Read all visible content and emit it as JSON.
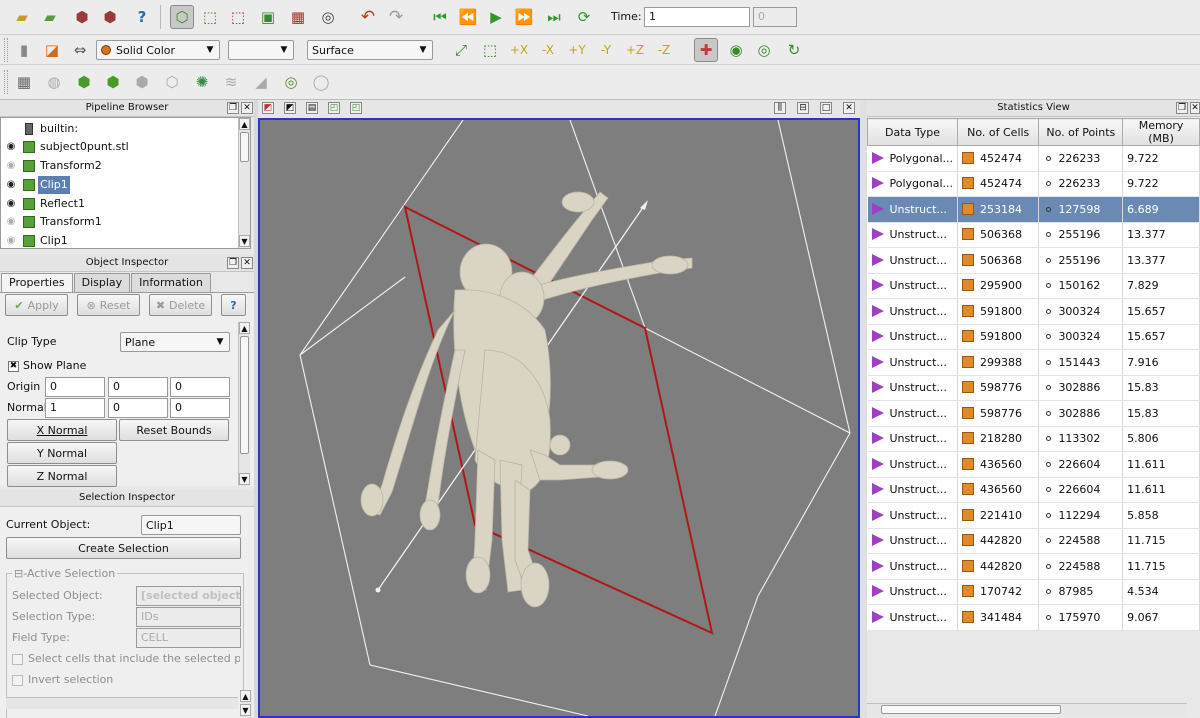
{
  "toolbar1": {
    "time_label": "Time:",
    "time_value": "1",
    "time_step": "0"
  },
  "toolbar2": {
    "color_by": "Solid Color",
    "color_component": "",
    "representation": "Surface"
  },
  "pipeline_browser": {
    "title": "Pipeline Browser",
    "items": [
      {
        "label": "builtin:",
        "visible": null
      },
      {
        "label": "subject0punt.stl",
        "visible": true
      },
      {
        "label": "Transform2",
        "visible": false
      },
      {
        "label": "Clip1",
        "visible": true,
        "selected": true
      },
      {
        "label": "Reflect1",
        "visible": true
      },
      {
        "label": "Transform1",
        "visible": false
      },
      {
        "label": "Clip1",
        "visible": false
      }
    ]
  },
  "object_inspector": {
    "title": "Object Inspector",
    "tabs": [
      "Properties",
      "Display",
      "Information"
    ],
    "apply": "Apply",
    "reset": "Reset",
    "delete": "Delete",
    "help": "?",
    "clip_type_label": "Clip Type",
    "clip_type_value": "Plane",
    "show_plane": "Show Plane",
    "origin_label": "Origin",
    "origin": [
      "0",
      "0",
      "0"
    ],
    "normal_label": "Normal",
    "normal": [
      "1",
      "0",
      "0"
    ],
    "x_normal": "X Normal",
    "y_normal": "Y Normal",
    "z_normal": "Z Normal",
    "reset_bounds": "Reset Bounds"
  },
  "selection_inspector": {
    "title": "Selection Inspector",
    "current_object_label": "Current Object:",
    "current_object_value": "Clip1",
    "create_selection": "Create Selection",
    "active_selection": "Active Selection",
    "selected_object_label": "Selected Object:",
    "selected_object_value": "[selected object n",
    "selection_type_label": "Selection Type:",
    "selection_type_value": "IDs",
    "field_type_label": "Field Type:",
    "field_type_value": "CELL",
    "select_cells": "Select cells that include the selected poir",
    "invert_selection": "Invert selection"
  },
  "statistics_view": {
    "title": "Statistics View",
    "columns": [
      "Data Type",
      "No. of Cells",
      "No. of Points",
      "Memory (MB)"
    ],
    "rows": [
      [
        "Polygonal...",
        "452474",
        "226233",
        "9.722"
      ],
      [
        "Polygonal...",
        "452474",
        "226233",
        "9.722"
      ],
      [
        "Unstruct...",
        "253184",
        "127598",
        "6.689"
      ],
      [
        "Unstruct...",
        "506368",
        "255196",
        "13.377"
      ],
      [
        "Unstruct...",
        "506368",
        "255196",
        "13.377"
      ],
      [
        "Unstruct...",
        "295900",
        "150162",
        "7.829"
      ],
      [
        "Unstruct...",
        "591800",
        "300324",
        "15.657"
      ],
      [
        "Unstruct...",
        "591800",
        "300324",
        "15.657"
      ],
      [
        "Unstruct...",
        "299388",
        "151443",
        "7.916"
      ],
      [
        "Unstruct...",
        "598776",
        "302886",
        "15.83"
      ],
      [
        "Unstruct...",
        "598776",
        "302886",
        "15.83"
      ],
      [
        "Unstruct...",
        "218280",
        "113302",
        "5.806"
      ],
      [
        "Unstruct...",
        "436560",
        "226604",
        "11.611"
      ],
      [
        "Unstruct...",
        "436560",
        "226604",
        "11.611"
      ],
      [
        "Unstruct...",
        "221410",
        "112294",
        "5.858"
      ],
      [
        "Unstruct...",
        "442820",
        "224588",
        "11.715"
      ],
      [
        "Unstruct...",
        "442820",
        "224588",
        "11.715"
      ],
      [
        "Unstruct...",
        "170742",
        "87985",
        "4.534"
      ],
      [
        "Unstruct...",
        "341484",
        "175970",
        "9.067"
      ]
    ],
    "selected_row": 2
  },
  "colors": {
    "selection": "#6a8ab4",
    "viewport_bg": "#7e7e7e",
    "view_border": "#2a36c8",
    "clip_plane": "#b01818",
    "model": "#d9d4c3"
  }
}
